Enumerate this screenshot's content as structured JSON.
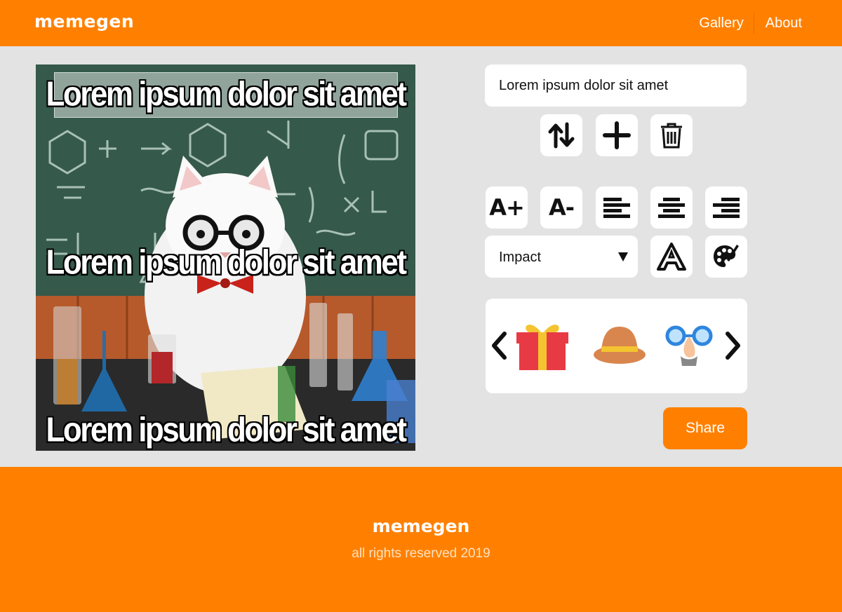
{
  "header": {
    "logo": "memegen",
    "nav": [
      {
        "label": "Gallery"
      },
      {
        "label": "About"
      }
    ]
  },
  "meme": {
    "lines": [
      "Lorem ipsum dolor sit amet",
      "Lorem ipsum dolor sit amet",
      "Lorem ipsum dolor sit amet"
    ]
  },
  "editor": {
    "line_text_value": "Lorem ipsum dolor sit amet",
    "tools": {
      "increase_font": "A+",
      "decrease_font": "A-"
    },
    "font_select_value": "Impact",
    "stickers": [
      "gift",
      "hat",
      "glasses-nose"
    ],
    "share_label": "Share"
  },
  "footer": {
    "logo": "memegen",
    "rights": "all rights reserved 2019"
  },
  "colors": {
    "brand": "#ff8000",
    "background": "#e3e3e3"
  }
}
